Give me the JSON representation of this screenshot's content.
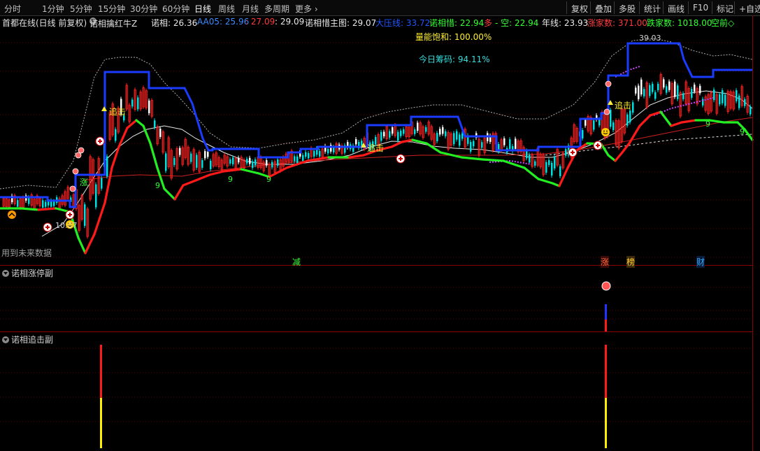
{
  "toolbar": {
    "timeframes": [
      "分时",
      "1分钟",
      "5分钟",
      "15分钟",
      "30分钟",
      "60分钟",
      "日线",
      "周线",
      "月线",
      "多周期",
      "更多"
    ],
    "active_timeframe": "日线",
    "right_buttons": [
      "复权",
      "叠加",
      "多股",
      "统计",
      "画线",
      "F10",
      "标记",
      "+自选"
    ]
  },
  "main": {
    "stock_title": "首都在线(日线 前复权)",
    "indicator_name": "诺相擒红牛Z",
    "values": [
      {
        "label": "诺相: 26.36",
        "color": "#e8e8e8"
      },
      {
        "label": "AA05: 25.96",
        "color": "#3a8cff"
      },
      {
        "label": ": 27.09",
        "color": "#ff3b3b"
      },
      {
        "label": ": 29.09",
        "color": "#e8e8e8"
      },
      {
        "label": "诺相惜主图: 29.07",
        "color": "#e8e8e8"
      },
      {
        "label": "大压线: 33.72",
        "color": "#2255ff"
      },
      {
        "label": "诺相惜: 22.94",
        "color": "#33ff33"
      },
      {
        "label": "多",
        "color": "#ff3b3b"
      },
      {
        "label": "- 空: 22.94",
        "color": "#33ff33"
      },
      {
        "label": "年线: 23.93",
        "color": "#e8e8e8"
      },
      {
        "label": "涨家数: 371.00",
        "color": "#ff3b3b"
      },
      {
        "label": "跌家数: 1018.00",
        "color": "#33ff33"
      },
      {
        "label": "空前◇",
        "color": "#33ff33"
      }
    ],
    "energy_label": "量能饱和: 100.00%",
    "chips_label": "今日筹码: 94.11%",
    "future_note": "用到未来数据",
    "high_price": "39.03",
    "low_price": "10.07",
    "annotations": {
      "zhui_ji": "追击",
      "zhang": "涨",
      "nine": "9"
    },
    "bottom_tags": [
      {
        "text": "减",
        "color": "#33ff33"
      },
      {
        "text": "涨",
        "color": "#ff6633"
      },
      {
        "text": "榜",
        "color": "#ffcc33"
      },
      {
        "text": "财",
        "color": "#33aaff"
      }
    ]
  },
  "sub1": {
    "title": "诺相涨停副"
  },
  "sub2": {
    "title": "诺相追击副"
  },
  "colors": {
    "resistance": "#1a3cff",
    "support_red": "#ff1a1a",
    "support_green": "#22ee22",
    "candle_up": "#ff2020",
    "candle_down": "#00e0e0",
    "separator": "#8b0000"
  }
}
